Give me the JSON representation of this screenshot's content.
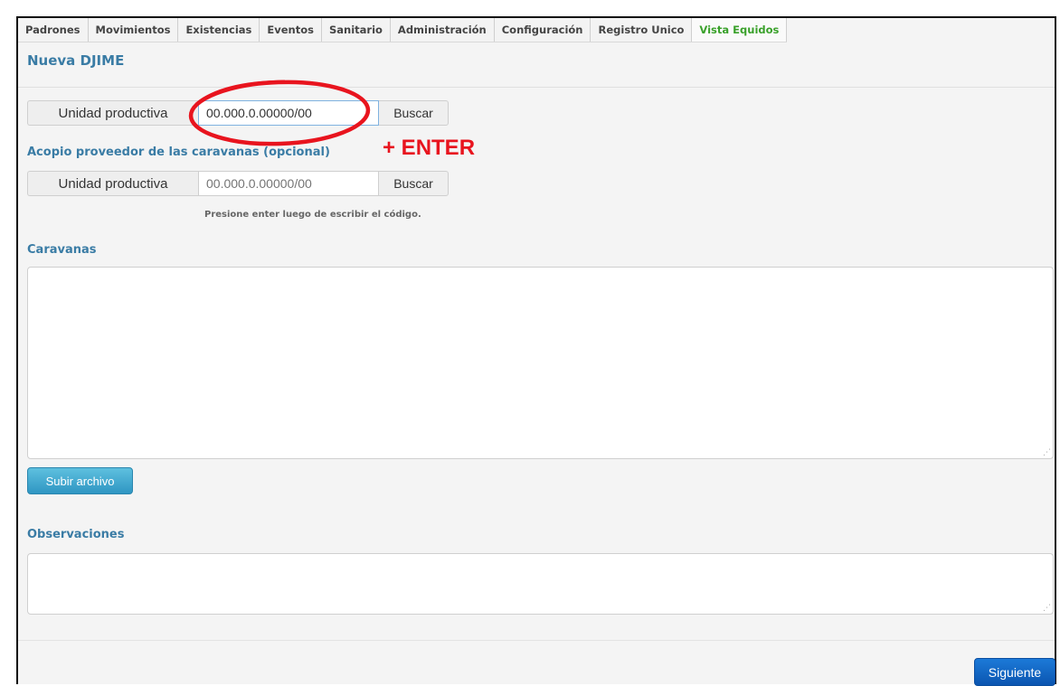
{
  "nav": {
    "tabs": [
      {
        "label": "Padrones"
      },
      {
        "label": "Movimientos"
      },
      {
        "label": "Existencias"
      },
      {
        "label": "Eventos"
      },
      {
        "label": "Sanitario"
      },
      {
        "label": "Administración"
      },
      {
        "label": "Configuración"
      },
      {
        "label": "Registro Unico"
      },
      {
        "label": "Vista Equidos",
        "active": true
      }
    ]
  },
  "page": {
    "title": "Nueva DJIME"
  },
  "unidad_productiva": {
    "label": "Unidad productiva",
    "value": "00.000.0.00000/00",
    "button": "Buscar"
  },
  "acopio": {
    "section_title": "Acopio proveedor de las caravanas (opcional)",
    "label": "Unidad productiva",
    "placeholder": "00.000.0.00000/00",
    "button": "Buscar",
    "hint": "Presione enter luego de escribir el código."
  },
  "caravanas": {
    "title": "Caravanas",
    "value": "",
    "upload_button": "Subir archivo"
  },
  "observaciones": {
    "title": "Observaciones",
    "value": ""
  },
  "footer": {
    "next_button": "Siguiente"
  },
  "annotation": {
    "text": "+ ENTER",
    "color": "#e8141e"
  },
  "colors": {
    "section_title": "#3a7ca5",
    "active_tab": "#3aa12b",
    "primary_button": "#0b55b0",
    "info_button": "#2f96c3"
  }
}
